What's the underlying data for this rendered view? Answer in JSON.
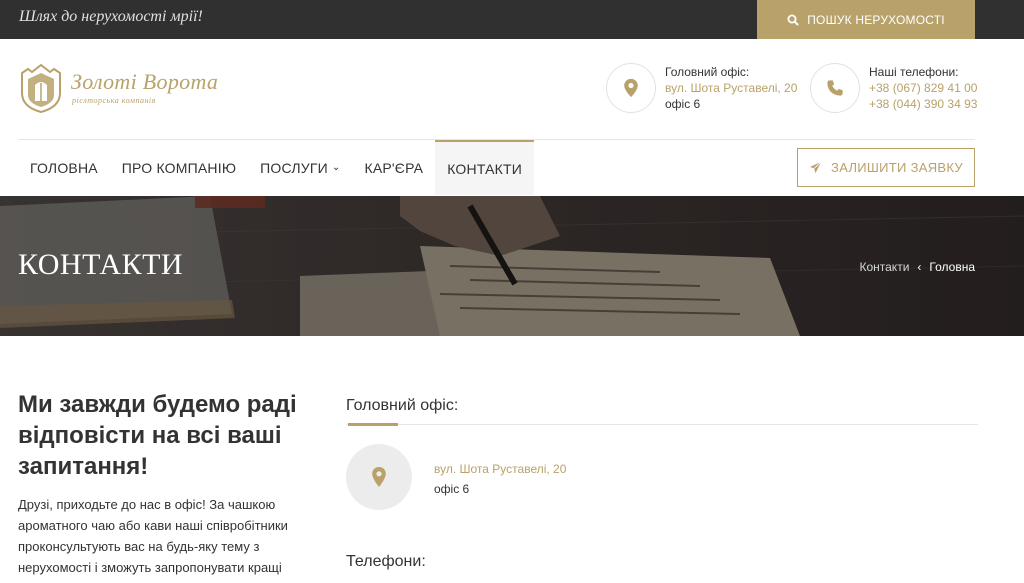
{
  "topbar": {
    "tagline": "Шлях до нерухомості мрії!",
    "search_label": "ПОШУК НЕРУХОМОСТІ"
  },
  "logo": {
    "title": "Золоті Ворота",
    "subtitle": "рієлторська компанія"
  },
  "header": {
    "office": {
      "label": "Головний офіс:",
      "street": "вул. Шота Руставелі, 20",
      "suite": "офіс 6",
      "icon": "map-pin-icon"
    },
    "phones": {
      "label": "Наші телефони:",
      "phone1": "+38 (067) 829 41 00",
      "phone2": "+38 (044) 390 34 93",
      "icon": "phone-icon"
    }
  },
  "nav": {
    "items": [
      {
        "label": "ГОЛОВНА"
      },
      {
        "label": "ПРО КОМПАНІЮ"
      },
      {
        "label": "ПОСЛУГИ"
      },
      {
        "label": "КАР'ЄРА"
      },
      {
        "label": "КОНТАКТИ",
        "active": true
      }
    ],
    "cta_label": "ЗАЛИШИТИ ЗАЯВКУ"
  },
  "hero": {
    "title": "КОНТАКТИ",
    "breadcrumb_current_page": "Контакти",
    "breadcrumb_home": "Головна"
  },
  "main": {
    "intro_title": "Ми завжди будемо раді відповісти на всі ваші запитання!",
    "intro_text": "Друзі, приходьте до нас в офіс! За чашкою ароматного чаю або кави наші співробітники проконсультують вас на будь-яку тему з нерухомості і зможуть запропонувати кращі",
    "office_heading": "Головний офіс:",
    "office_street": "вул. Шота Руставелі, 20",
    "office_suite": "офіс 6",
    "phones_heading": "Телефони:"
  },
  "colors": {
    "accent": "#b9a26a",
    "topbar_bg": "#303030",
    "text": "#333333"
  }
}
